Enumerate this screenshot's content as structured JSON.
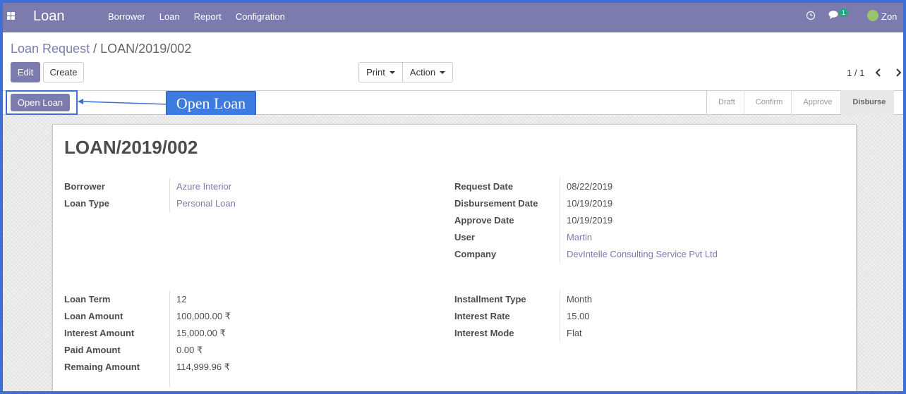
{
  "navbar": {
    "app_title": "Loan",
    "menu": [
      "Borrower",
      "Loan",
      "Report",
      "Configration"
    ],
    "chat_count": "1",
    "user": "Zon"
  },
  "breadcrumb": {
    "parent": "Loan Request",
    "separator": "/",
    "current": "LOAN/2019/002"
  },
  "buttons": {
    "edit": "Edit",
    "create": "Create",
    "print": "Print",
    "action": "Action",
    "open_loan": "Open Loan"
  },
  "pager": {
    "value": "1 / 1"
  },
  "stages": [
    "Draft",
    "Confirm",
    "Approve",
    "Disburse"
  ],
  "active_stage": "Disburse",
  "annotation": {
    "label": "Open Loan"
  },
  "record": {
    "title": "LOAN/2019/002",
    "left_top": [
      {
        "label": "Borrower",
        "value": "Azure Interior",
        "link": true
      },
      {
        "label": "Loan Type",
        "value": "Personal Loan",
        "link": true
      }
    ],
    "right_top": [
      {
        "label": "Request Date",
        "value": "08/22/2019",
        "link": false
      },
      {
        "label": "Disbursement Date",
        "value": "10/19/2019",
        "link": false
      },
      {
        "label": "Approve Date",
        "value": "10/19/2019",
        "link": false
      },
      {
        "label": "User",
        "value": "Martin",
        "link": true
      },
      {
        "label": "Company",
        "value": "DevIntelle Consulting Service Pvt Ltd",
        "link": true
      }
    ],
    "left_bottom": [
      {
        "label": "Loan Term",
        "value": "12",
        "link": false
      },
      {
        "label": "Loan Amount",
        "value": "100,000.00 ₹",
        "link": false
      },
      {
        "label": "Interest Amount",
        "value": "15,000.00 ₹",
        "link": false
      },
      {
        "label": "Paid Amount",
        "value": "0.00 ₹",
        "link": false
      },
      {
        "label": "Remaing Amount",
        "value": "114,999.96 ₹",
        "link": false
      }
    ],
    "right_bottom": [
      {
        "label": "Installment Type",
        "value": "Month",
        "link": false
      },
      {
        "label": "Interest Rate",
        "value": "15.00",
        "link": false
      },
      {
        "label": "Interest Mode",
        "value": "Flat",
        "link": false
      }
    ]
  },
  "colors": {
    "brand": "#7c7bad",
    "annotation": "#3e7be0",
    "frame": "#3e6fd6"
  }
}
